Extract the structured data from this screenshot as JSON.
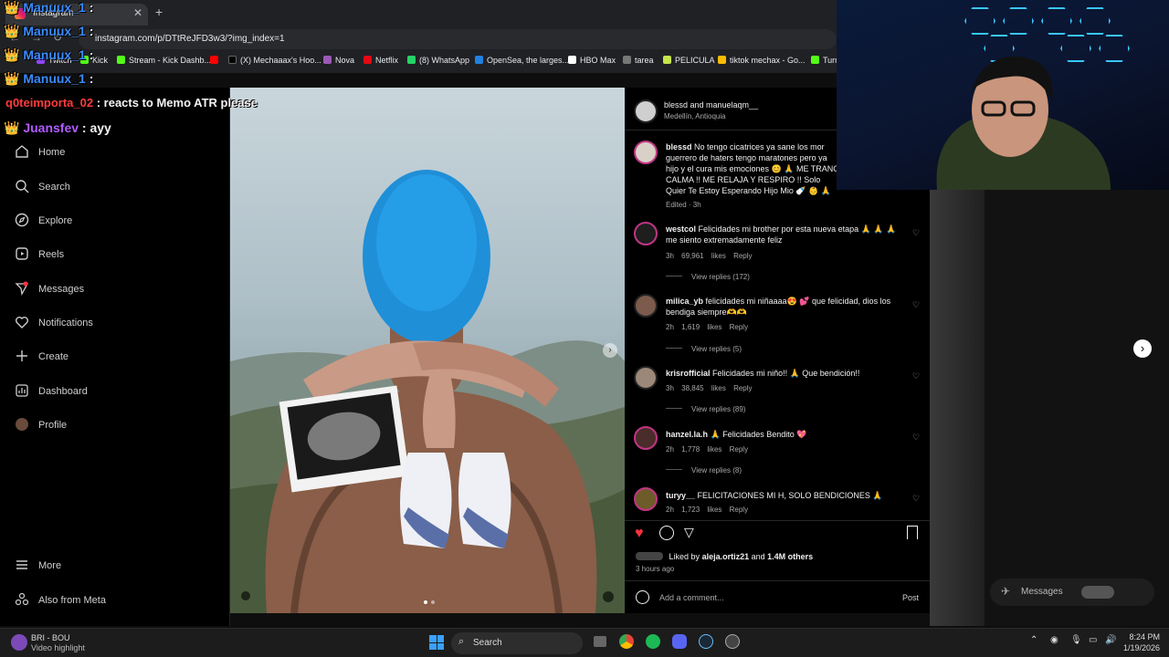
{
  "browser": {
    "tab_title": "Instagram",
    "url": "instagram.com/p/DTtReJFD3w3/?img_index=1",
    "bookmarks": [
      "Twitch",
      "Kick",
      "Stream - Kick Dashb...",
      "",
      "(X) Mechaaax's Hoo...",
      "Nova",
      "Netflix",
      "(8) WhatsApp",
      "OpenSea, the larges...",
      "HBO Max",
      "tarea",
      "PELICULA",
      "tiktok mechax - Go...",
      "Turn"
    ]
  },
  "chat_overlay": [
    {
      "user": "Manuux_1",
      "msg": ":",
      "color": "#3b8bff"
    },
    {
      "user": "Manuux_1",
      "msg": ":",
      "color": "#3b8bff"
    },
    {
      "user": "Manuux_1",
      "msg": ":",
      "color": "#3b8bff"
    },
    {
      "user": "Manuux_1",
      "msg": ":",
      "color": "#3b8bff"
    },
    {
      "user": "q0teimporta_02",
      "msg": ": reacts to Memo ATR please",
      "color": "#ff3b3b"
    },
    {
      "user": "Juansfev",
      "msg": ": ayy",
      "color": "#b05bff"
    }
  ],
  "sidenav": {
    "items": [
      "Home",
      "Search",
      "Explore",
      "Reels",
      "Messages",
      "Notifications",
      "Create",
      "Dashboard",
      "Profile"
    ],
    "bottom": [
      "More",
      "Also from Meta"
    ]
  },
  "post": {
    "header_users": "blessd and manuelaqm__",
    "location": "Medellín, Antioquia",
    "caption_user": "blessd",
    "caption": "No tengo cicatrices ya sane los mor guerrero de haters tengo maratones pero ya hijo y el cura mis emociones 😊 🙏 ME TRANC CALMA !! ME RELAJA Y RESPIRO !! Solo Quier Te Estoy Esperando Hijo Mio 🍼 👶 🙏 🙏",
    "edited": "Edited · 3h",
    "comments": [
      {
        "user": "westcol",
        "text": "Felicidades mi brother por esta nueva etapa 🙏 🙏 🙏 me siento extremadamente feliz",
        "time": "3h",
        "likes": "69,961 likes",
        "reply": "Reply",
        "replies": "View replies (172)"
      },
      {
        "user": "milica_yb",
        "text": "felicidades mi niñaaaa😍 💕 que felicidad, dios los bendiga siempre🫶🫶",
        "time": "2h",
        "likes": "1,619 likes",
        "reply": "Reply",
        "replies": "View replies (5)"
      },
      {
        "user": "krisrofficial",
        "text": "Felicidades mi niño!! 🙏 Que bendición!!",
        "time": "3h",
        "likes": "38,845 likes",
        "reply": "Reply",
        "replies": "View replies (89)"
      },
      {
        "user": "hanzel.la.h",
        "text": "🙏 Felicidades Bendito 💖",
        "time": "2h",
        "likes": "1,778 likes",
        "reply": "Reply",
        "replies": "View replies (8)"
      },
      {
        "user": "turyy__",
        "text": "FELICITACIONES MI H, SOLO BENDICIONES 🙏",
        "time": "2h",
        "likes": "1,723 likes",
        "reply": "Reply",
        "replies": ""
      }
    ],
    "liked_by": "Liked by",
    "liked_user": "aleja.ortiz21",
    "liked_and": "and",
    "liked_others": "1.4M others",
    "time_ago": "3 hours ago",
    "comment_placeholder": "Add a comment...",
    "post_button": "Post"
  },
  "right": {
    "messages": "Messages"
  },
  "taskbar": {
    "media_title": "BRI - BOU",
    "media_sub": "Video highlight",
    "search": "Search",
    "time": "8:24 PM",
    "date": "1/19/2026"
  },
  "colors": {
    "accent": "#0095f6",
    "like": "#ff3040"
  }
}
